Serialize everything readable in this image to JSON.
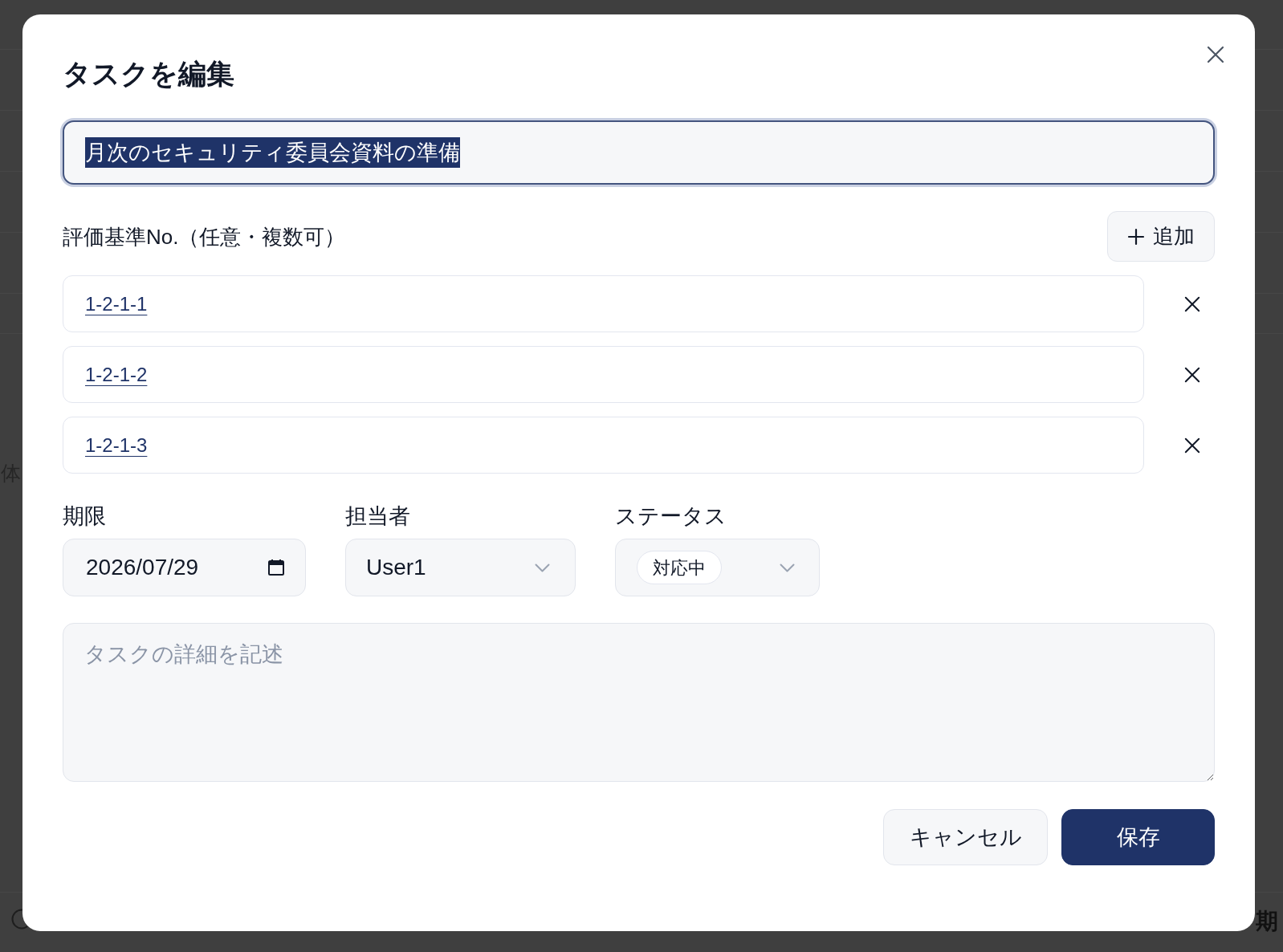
{
  "background": {
    "left_text": "体",
    "right_text": "期"
  },
  "dialog": {
    "title": "タスクを編集",
    "title_field": {
      "value": "月次のセキュリティ委員会資料の準備",
      "focused": true,
      "value_selected": true
    },
    "criteria": {
      "label": "評価基準No.（任意・複数可）",
      "add_button": "追加",
      "items": [
        {
          "value": "1-2-1-1"
        },
        {
          "value": "1-2-1-2"
        },
        {
          "value": "1-2-1-3"
        }
      ]
    },
    "fields": [
      {
        "kind": "date",
        "label": "期限",
        "value": "2026/07/29"
      },
      {
        "kind": "select",
        "label": "担当者",
        "value": "User1"
      },
      {
        "kind": "status",
        "label": "ステータス",
        "value": "対応中"
      }
    ],
    "description": {
      "placeholder": "タスクの詳細を記述"
    },
    "buttons": [
      {
        "label": "キャンセル",
        "kind": "secondary"
      },
      {
        "label": "保存",
        "kind": "primary"
      }
    ]
  }
}
